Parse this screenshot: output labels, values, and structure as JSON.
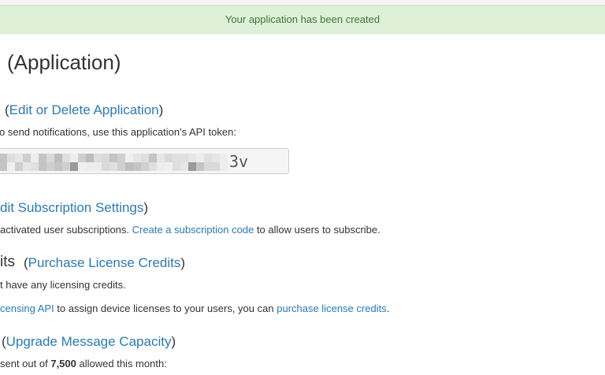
{
  "alert": {
    "message": "Your application has been created"
  },
  "header": {
    "title": "(Application)"
  },
  "api_token_section": {
    "open_paren": "(",
    "edit_link": "Edit or Delete Application",
    "close_paren": ")",
    "description": "o send notifications, use this application's API token:",
    "token_visible_tail": "3v"
  },
  "subscription_section": {
    "link": "dit Subscription Settings",
    "close_paren": ")",
    "text_before": "activated user subscriptions.",
    "create_code_link": "Create a subscription code",
    "text_after": "to allow users to subscribe."
  },
  "licensing_section": {
    "heading_fragment": "its",
    "open_paren": "(",
    "purchase_link": "Purchase License Credits",
    "close_paren": ")",
    "no_credits_text": "t have any licensing credits.",
    "api_link": "censing API",
    "middle_text": "to assign device licenses to your users, you can",
    "purchase_credits_link": "purchase license credits",
    "end_period": "."
  },
  "message_capacity_section": {
    "open_paren": "(",
    "upgrade_link": "Upgrade Message Capacity",
    "close_paren": ")",
    "text_before": "sent out of",
    "limit": "7,500",
    "text_after": "allowed this month:"
  },
  "colors": {
    "link": "#2a7ab8",
    "alert_bg": "#dff0d8",
    "alert_text": "#3c763d",
    "text": "#333333"
  }
}
